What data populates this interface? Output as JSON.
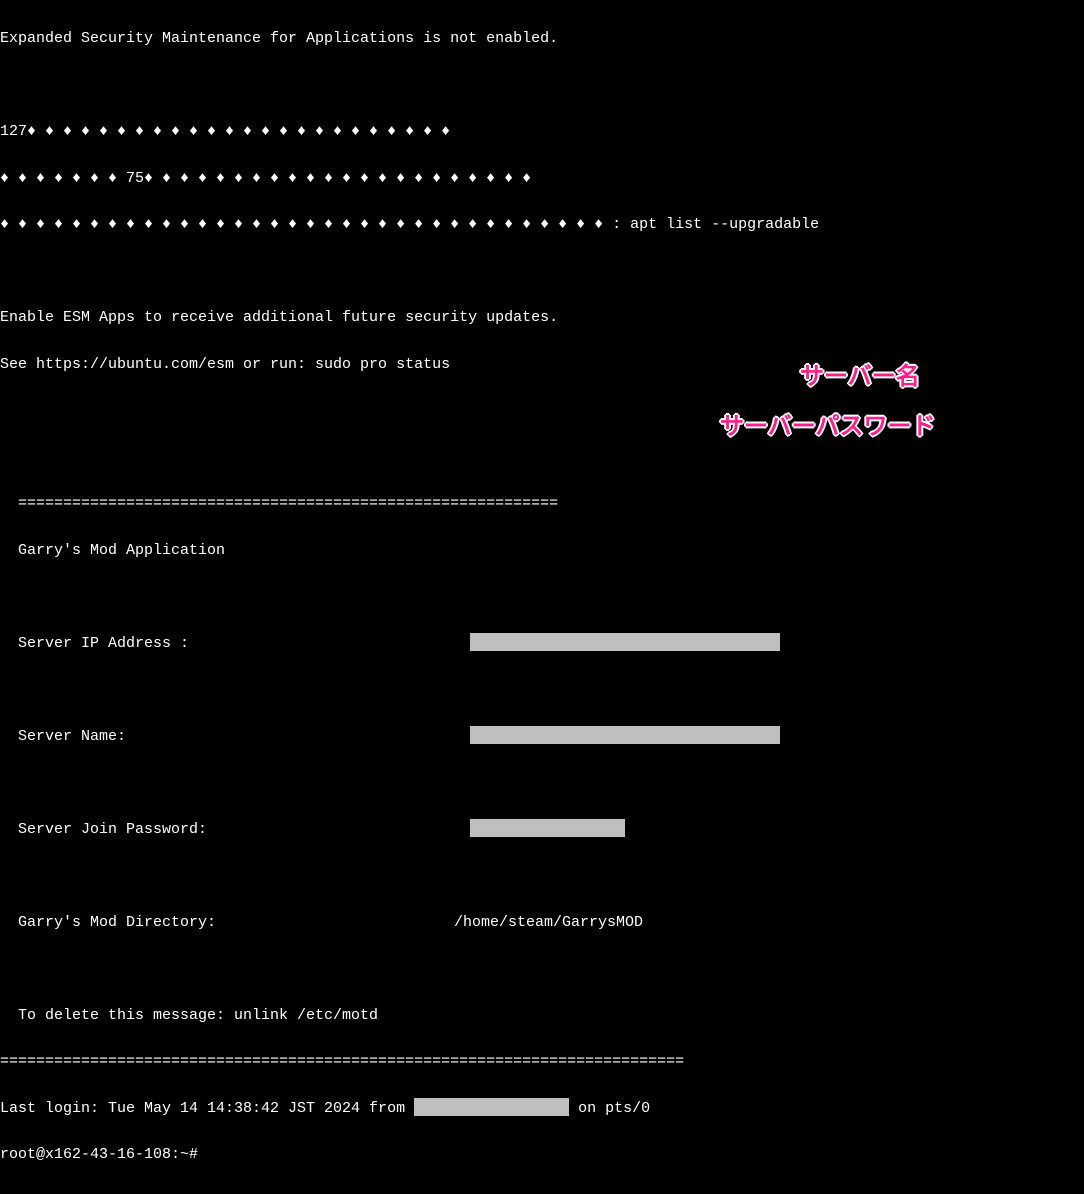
{
  "esm": {
    "not_enabled": "Expanded Security Maintenance for Applications is not enabled.",
    "diamond_line_1": "127♦ ♦ ♦ ♦ ♦ ♦ ♦ ♦ ♦ ♦ ♦ ♦ ♦ ♦ ♦ ♦ ♦ ♦ ♦ ♦ ♦ ♦ ♦ ♦",
    "diamond_line_2": "♦ ♦ ♦ ♦ ♦ ♦ ♦ 75♦ ♦ ♦ ♦ ♦ ♦ ♦ ♦ ♦ ♦ ♦ ♦ ♦ ♦ ♦ ♦ ♦ ♦ ♦ ♦ ♦ ♦",
    "diamond_line_3": "♦ ♦ ♦ ♦ ♦ ♦ ♦ ♦ ♦ ♦ ♦ ♦ ♦ ♦ ♦ ♦ ♦ ♦ ♦ ♦ ♦ ♦ ♦ ♦ ♦ ♦ ♦ ♦ ♦ ♦ ♦ ♦ ♦ ♦ : apt list --upgradable",
    "enable_msg": "Enable ESM Apps to receive additional future security updates.",
    "see_msg": "See https://ubuntu.com/esm or run: sudo pro status"
  },
  "app": {
    "sep_top": "  ============================================================",
    "title": "  Garry's Mod Application",
    "ip_label": "  Server IP Address :",
    "name_label": "  Server Name:",
    "pw_label": "  Server Join Password:",
    "dir_label": "  Garry's Mod Directory:",
    "dir_value": "  /home/steam/GarrysMOD",
    "delete_msg": "  To delete this message: unlink /etc/motd",
    "sep_bot": "============================================================================"
  },
  "login": {
    "prefix": "Last login: Tue May 14 14:38:42 JST 2024 from ",
    "suffix": " on pts/0"
  },
  "prompt": "root@x162-43-16-108:~#",
  "annotations": {
    "server_name": "サーバー名",
    "server_password": "サーバーパスワード"
  }
}
